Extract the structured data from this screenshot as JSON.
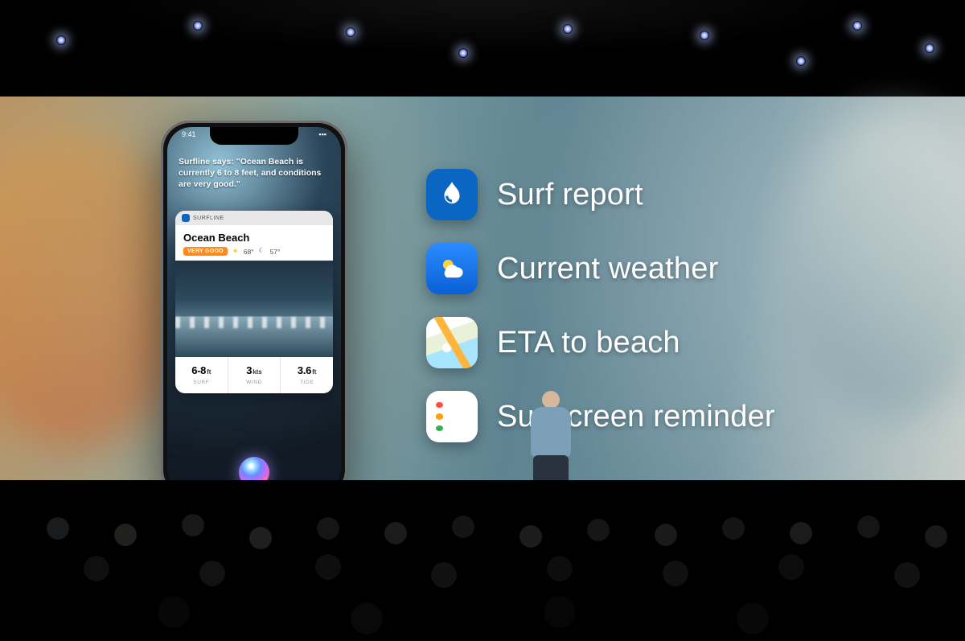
{
  "phone": {
    "statusbar_time": "9:41",
    "siri_response": "Surfline says: \"Ocean Beach is currently 6 to 8 feet, and conditions are very good.\"",
    "card": {
      "app_name": "SURFLINE",
      "location_name": "Ocean Beach",
      "condition_badge": "VERY GOOD",
      "temp_high": "68°",
      "temp_low": "57°",
      "stats": [
        {
          "value": "6-8",
          "unit": "ft",
          "label": "SURF"
        },
        {
          "value": "3",
          "unit": "kts",
          "label": "WIND"
        },
        {
          "value": "3.6",
          "unit": "ft",
          "label": "TIDE"
        }
      ]
    }
  },
  "features": [
    {
      "icon": "surfline-icon",
      "label": "Surf report"
    },
    {
      "icon": "weather-icon",
      "label": "Current weather"
    },
    {
      "icon": "maps-icon",
      "label": "ETA to beach"
    },
    {
      "icon": "reminders-icon",
      "label": "Sunscreen reminder"
    }
  ]
}
